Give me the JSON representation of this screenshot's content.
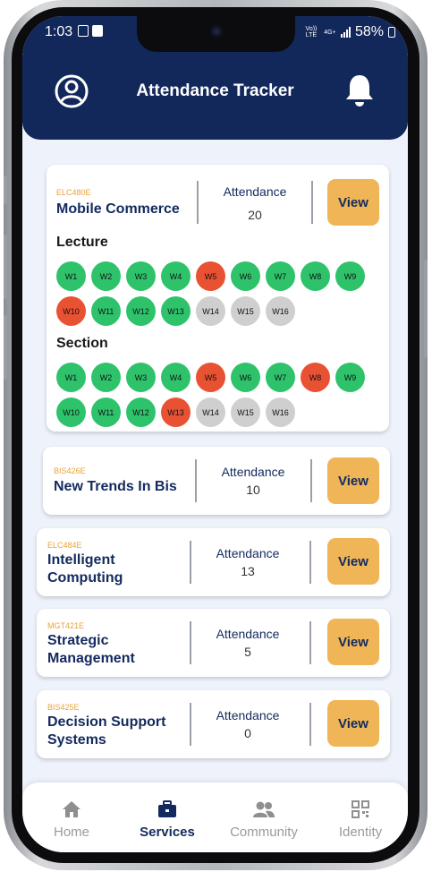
{
  "status": {
    "time": "1:03",
    "network": "Vo)) LTE",
    "net_type": "4G+",
    "battery": "58%"
  },
  "header": {
    "title": "Attendance Tracker",
    "profile_icon": "account-circle-icon",
    "bell_icon": "bell-icon"
  },
  "expanded_course": {
    "code": "ELC480E",
    "name": "Mobile Commerce",
    "attendance_label": "Attendance",
    "attendance": "20",
    "view_label": "View",
    "lecture_title": "Lecture",
    "section_title": "Section",
    "lecture": [
      {
        "label": "W1",
        "status": "present"
      },
      {
        "label": "W2",
        "status": "present"
      },
      {
        "label": "W3",
        "status": "present"
      },
      {
        "label": "W4",
        "status": "present"
      },
      {
        "label": "W5",
        "status": "absent"
      },
      {
        "label": "W6",
        "status": "present"
      },
      {
        "label": "W7",
        "status": "present"
      },
      {
        "label": "W8",
        "status": "present"
      },
      {
        "label": "W9",
        "status": "present"
      },
      {
        "label": "W10",
        "status": "absent"
      },
      {
        "label": "W11",
        "status": "present"
      },
      {
        "label": "W12",
        "status": "present"
      },
      {
        "label": "W13",
        "status": "present"
      },
      {
        "label": "W14",
        "status": "pending"
      },
      {
        "label": "W15",
        "status": "pending"
      },
      {
        "label": "W16",
        "status": "pending"
      }
    ],
    "section": [
      {
        "label": "W1",
        "status": "present"
      },
      {
        "label": "W2",
        "status": "present"
      },
      {
        "label": "W3",
        "status": "present"
      },
      {
        "label": "W4",
        "status": "present"
      },
      {
        "label": "W5",
        "status": "absent"
      },
      {
        "label": "W6",
        "status": "present"
      },
      {
        "label": "W7",
        "status": "present"
      },
      {
        "label": "W8",
        "status": "absent"
      },
      {
        "label": "W9",
        "status": "present"
      },
      {
        "label": "W10",
        "status": "present"
      },
      {
        "label": "W11",
        "status": "present"
      },
      {
        "label": "W12",
        "status": "present"
      },
      {
        "label": "W13",
        "status": "absent"
      },
      {
        "label": "W14",
        "status": "pending"
      },
      {
        "label": "W15",
        "status": "pending"
      },
      {
        "label": "W16",
        "status": "pending"
      }
    ]
  },
  "courses": [
    {
      "code": "BIS426E",
      "name": "New Trends In Bis",
      "attendance_label": "Attendance",
      "attendance": "10",
      "view_label": "View"
    },
    {
      "code": "ELC484E",
      "name": "Intelligent Computing",
      "attendance_label": "Attendance",
      "attendance": "13",
      "view_label": "View"
    },
    {
      "code": "MGT421E",
      "name": "Strategic Management",
      "attendance_label": "Attendance",
      "attendance": "5",
      "view_label": "View"
    },
    {
      "code": "BIS425E",
      "name": "Decision Support Systems",
      "attendance_label": "Attendance",
      "attendance": "0",
      "view_label": "View"
    }
  ],
  "bottom_nav": [
    {
      "label": "Home",
      "icon": "home-icon",
      "active": false
    },
    {
      "label": "Services",
      "icon": "briefcase-icon",
      "active": true
    },
    {
      "label": "Community",
      "icon": "people-icon",
      "active": false
    },
    {
      "label": "Identity",
      "icon": "qr-code-icon",
      "active": false
    }
  ],
  "colors": {
    "header": "#12275a",
    "present": "#2ec36b",
    "absent": "#e85233",
    "pending": "#cfcfcf",
    "button": "#efb556",
    "code": "#e8a33a"
  }
}
